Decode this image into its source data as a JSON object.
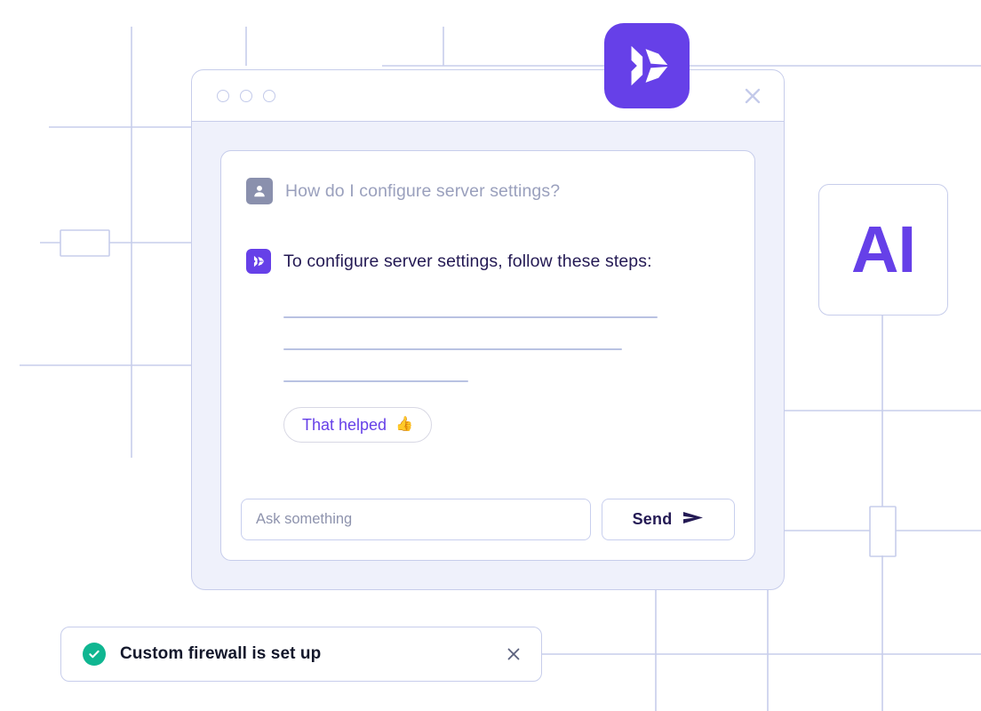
{
  "brand": {
    "badge_icon": "brand-arrow-logo",
    "accent_purple": "#6640e8",
    "border_lavender": "#c7cdeb",
    "panel_lavender": "#eff1fb",
    "success_green": "#0fb691",
    "ink_navy": "#241a54"
  },
  "window": {
    "titlebar": {
      "dots": [
        "dot-one",
        "dot-two",
        "dot-three"
      ],
      "close_icon": "close-icon"
    }
  },
  "conversation": {
    "messages": [
      {
        "role": "user",
        "avatar_icon": "user-avatar-icon",
        "text": "How do I configure server settings?"
      },
      {
        "role": "assistant",
        "avatar_icon": "brand-arrow-logo",
        "text": "To configure server settings, follow these steps:"
      }
    ],
    "answer_skeleton_lines": [
      421,
      381,
      208
    ]
  },
  "feedback": {
    "label": "That helped",
    "emoji": "👍",
    "icon": "thumbs-up-icon"
  },
  "composer": {
    "input_value": "",
    "placeholder": "Ask something",
    "send_label": "Send",
    "send_icon": "paper-plane-icon"
  },
  "ai_tile": {
    "label": "AI"
  },
  "toast": {
    "status_icon": "check-circle-icon",
    "message": "Custom firewall is set up",
    "close_icon": "close-icon"
  }
}
